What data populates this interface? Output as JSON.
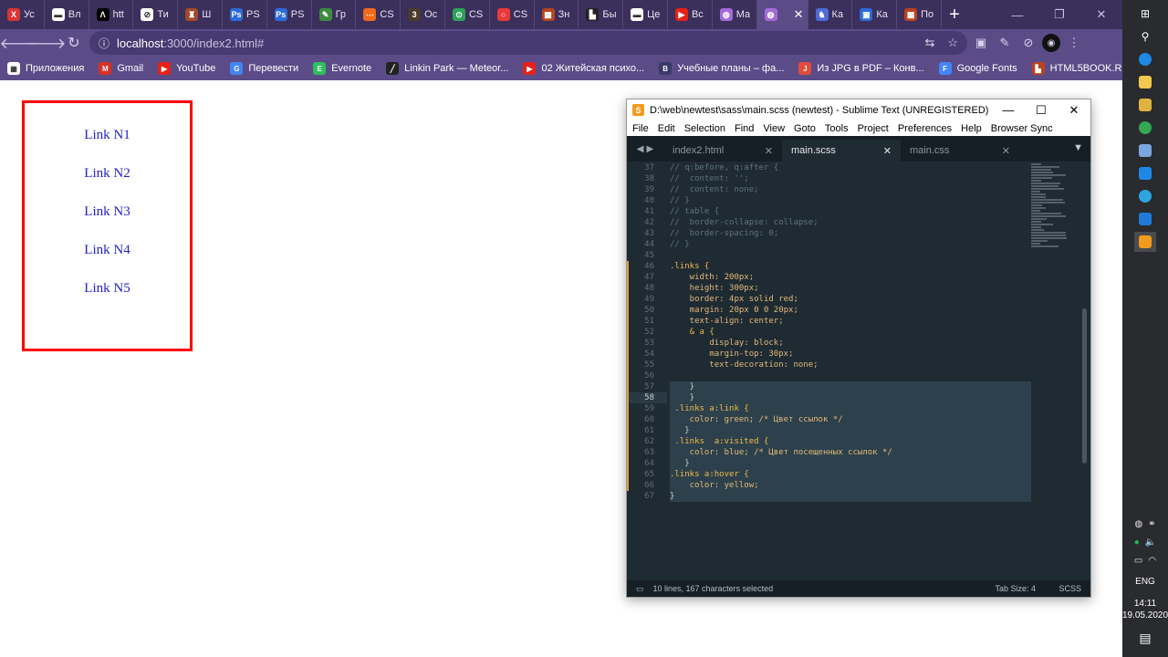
{
  "browser": {
    "tabs": [
      {
        "label": "Ус",
        "color": "#d93636",
        "glyph": "X"
      },
      {
        "label": "Вл",
        "color": "#ffffff",
        "glyph": "▬"
      },
      {
        "label": "htt",
        "color": "#000000",
        "glyph": "Λ"
      },
      {
        "label": "Ти",
        "color": "#ffffff",
        "glyph": "⊘"
      },
      {
        "label": "Ш",
        "color": "#a14b2a",
        "glyph": "♜"
      },
      {
        "label": "PS",
        "color": "#2c6ad8",
        "glyph": "Ps"
      },
      {
        "label": "PS",
        "color": "#2c6ad8",
        "glyph": "Ps"
      },
      {
        "label": "Гр",
        "color": "#3d8c3d",
        "glyph": "✎"
      },
      {
        "label": "CS",
        "color": "#f06a1b",
        "glyph": "⋯"
      },
      {
        "label": "Ос",
        "color": "#4b3b2b",
        "glyph": "3"
      },
      {
        "label": "CS",
        "color": "#2aa35a",
        "glyph": "⊙"
      },
      {
        "label": "CS",
        "color": "#e83a3a",
        "glyph": "○"
      },
      {
        "label": "Зн",
        "color": "#b8441f",
        "glyph": "▦"
      },
      {
        "label": "Бы",
        "color": "#222222",
        "glyph": "▙"
      },
      {
        "label": "Це",
        "color": "#ffffff",
        "glyph": "▬"
      },
      {
        "label": "Вс",
        "color": "#e62117",
        "glyph": "▶"
      },
      {
        "label": "Ма",
        "color": "#a46bd6",
        "glyph": "◍"
      },
      {
        "label": "",
        "color": "#a46bd6",
        "glyph": "◍",
        "active": true
      },
      {
        "label": "Ка",
        "color": "#4f6bd6",
        "glyph": "♞"
      },
      {
        "label": "Ка",
        "color": "#2c6ad8",
        "glyph": "▣"
      },
      {
        "label": "По",
        "color": "#b8441f",
        "glyph": "▦"
      }
    ],
    "new_tab_label": "+",
    "window_buttons": [
      "—",
      "❐",
      "✕"
    ],
    "url_host": "localhost",
    "url_path": ":3000/index2.html#",
    "bookmarks": [
      {
        "label": "Приложения",
        "color": "#ffffff",
        "glyph": "▦"
      },
      {
        "label": "Gmail",
        "color": "#d93025",
        "glyph": "M"
      },
      {
        "label": "YouTube",
        "color": "#e62117",
        "glyph": "▶"
      },
      {
        "label": "Перевести",
        "color": "#4285f4",
        "glyph": "G"
      },
      {
        "label": "Evernote",
        "color": "#2dbe60",
        "glyph": "E"
      },
      {
        "label": "Linkin Park — Meteor...",
        "color": "#222222",
        "glyph": "╱"
      },
      {
        "label": "02 Житейская психо...",
        "color": "#e62117",
        "glyph": "▶"
      },
      {
        "label": "Учебные планы – фа...",
        "color": "#3a3a6a",
        "glyph": "B"
      },
      {
        "label": "Из JPG в PDF – Конв...",
        "color": "#e34b3b",
        "glyph": "J"
      },
      {
        "label": "Google Fonts",
        "color": "#4285f4",
        "glyph": "F"
      },
      {
        "label": "HTML5BOOK.RU - HT...",
        "color": "#b8441f",
        "glyph": "▙"
      }
    ],
    "bookmarks_more": "»"
  },
  "page": {
    "links": [
      "Link N1",
      "Link N2",
      "Link N3",
      "Link N4",
      "Link N5"
    ]
  },
  "sublime": {
    "title": "D:\\web\\newtest\\sass\\main.scss (newtest) - Sublime Text (UNREGISTERED)",
    "menu": [
      "File",
      "Edit",
      "Selection",
      "Find",
      "View",
      "Goto",
      "Tools",
      "Project",
      "Preferences",
      "Help",
      "Browser Sync"
    ],
    "tabs": [
      "index2.html",
      "main.scss",
      "main.css"
    ],
    "active_tab": "main.scss",
    "line_numbers": [
      "37",
      "38",
      "39",
      "40",
      "41",
      "42",
      "43",
      "44",
      "45",
      "46",
      "47",
      "48",
      "49",
      "50",
      "51",
      "52",
      "53",
      "54",
      "55",
      "56",
      "57",
      "58",
      "59",
      "60",
      "61",
      "62",
      "63",
      "64",
      "65",
      "66",
      "67"
    ],
    "highlight_line": "58",
    "code_lines": [
      "// q:before, q:after {",
      "//  content: '';",
      "//  content: none;",
      "// }",
      "// table {",
      "//  border-collapse: collapse;",
      "//  border-spacing: 0;",
      "// }",
      "",
      ".links {",
      "    width: 200px;",
      "    height: 300px;",
      "    border: 4px solid red;",
      "    margin: 20px 0 0 20px;",
      "    text-align: center;",
      "    & a {",
      "        display: block;",
      "        margin-top: 30px;",
      "        text-decoration: none;",
      "",
      "    }",
      "    }",
      " .links a:link {",
      "    color: green; /* Цвет ссылок */",
      "   }",
      " .links  a:visited {",
      "    color: blue; /* Цвет посещенных ссылок */",
      "   }",
      ".links a:hover {",
      "    color: yellow;",
      "}"
    ],
    "status_left": "10 lines, 167 characters selected",
    "status_tab": "Tab Size: 4",
    "status_syntax": "SCSS"
  },
  "taskbar": {
    "lang": "ENG",
    "time": "14:11",
    "date": "19.05.2020"
  }
}
